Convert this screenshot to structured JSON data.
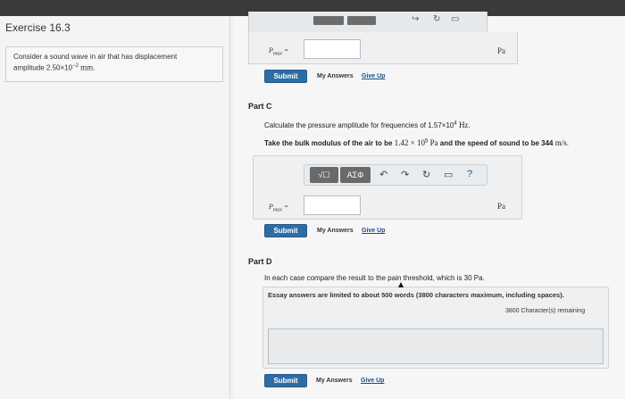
{
  "exercise": {
    "title": "Exercise 16.3",
    "problem_line1": "Consider a sound wave in air that has displacement",
    "problem_amp_prefix": "amplitude 2.50×10",
    "problem_amp_exp": "−2",
    "problem_amp_unit": "mm",
    "problem_end": "."
  },
  "toolbar_top": {
    "icon_undo": "redo-icon",
    "icon_reset": "reset-icon"
  },
  "part_b": {
    "var": "P",
    "var_sub": "max",
    "equals": "=",
    "unit": "Pa",
    "submit": "Submit",
    "my_answers": "My Answers",
    "give_up": "Give Up"
  },
  "part_c": {
    "title": "Part C",
    "q_prefix": "Calculate the pressure amplitude for frequencies of 1.57×10",
    "q_exp": "4",
    "q_unit": "Hz",
    "q_end": ".",
    "bulk_prefix": "Take the bulk modulus of the air to be ",
    "bulk_val": "1.42 × 10",
    "bulk_exp": "5",
    "bulk_unit": "Pa",
    "bulk_mid": " and the speed of sound to be 344 ",
    "bulk_speed_unit": "m/s",
    "bulk_end": ".",
    "tool_sqrt": "√☐",
    "tool_greek": "ΑΣΦ",
    "tool_help": "?",
    "var": "P",
    "var_sub": "max",
    "equals": "=",
    "unit": "Pa",
    "submit": "Submit",
    "my_answers": "My Answers",
    "give_up": "Give Up"
  },
  "part_d": {
    "title": "Part D",
    "question": "In each case compare the result to the pain threshold, which is 30 Pa.",
    "essay_note": "Essay answers are limited to about 500 words (3800 characters maximum, including spaces).",
    "char_count": "3800 Character(s) remaining",
    "submit": "Submit",
    "my_answers": "My Answers",
    "give_up": "Give Up"
  }
}
